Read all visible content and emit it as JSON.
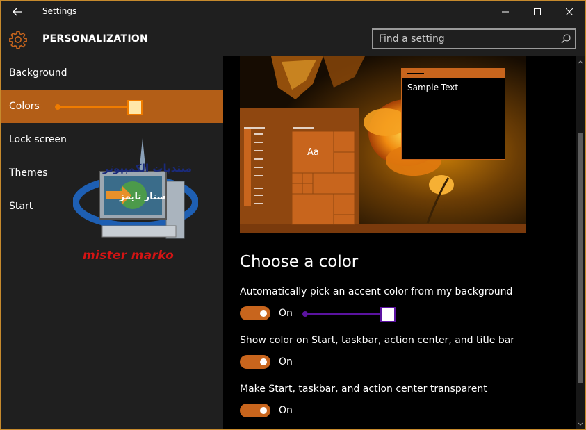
{
  "window": {
    "title": "Settings",
    "accent": "#c8651d",
    "controls": {
      "minimize": "minimize-icon",
      "maximize": "maximize-icon",
      "close": "close-icon"
    }
  },
  "header": {
    "title": "PERSONALIZATION",
    "icon": "gear-icon",
    "search": {
      "placeholder": "Find a setting",
      "value": ""
    }
  },
  "sidebar": {
    "items": [
      {
        "label": "Background",
        "selected": false
      },
      {
        "label": "Colors",
        "selected": true
      },
      {
        "label": "Lock screen",
        "selected": false
      },
      {
        "label": "Themes",
        "selected": false
      },
      {
        "label": "Start",
        "selected": false
      }
    ]
  },
  "preview": {
    "tile_label": "Aa",
    "sample_text": "Sample Text"
  },
  "section": {
    "title": "Choose a color",
    "settings": [
      {
        "label": "Automatically pick an accent color from my background",
        "state": "On"
      },
      {
        "label": "Show color on Start, taskbar, action center, and title bar",
        "state": "On"
      },
      {
        "label": "Make Start, taskbar, and action center transparent",
        "state": "On"
      }
    ]
  },
  "watermark": {
    "arabic_top": "منتديات الكمبيوتر",
    "arabic_screen": "ستار تايمز",
    "author": "mister marko"
  },
  "annotation_colors": {
    "sidebar": "#f07c00",
    "toggle": "#5b13a0"
  }
}
